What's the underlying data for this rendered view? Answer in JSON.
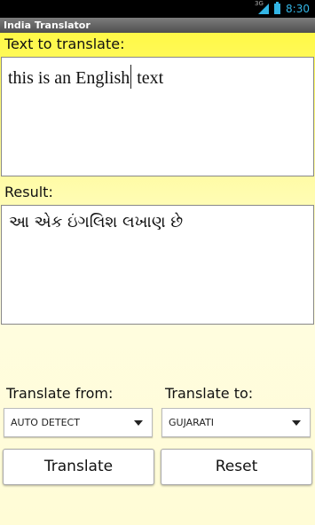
{
  "status_bar": {
    "network_label": "3G",
    "time": "8:30"
  },
  "app": {
    "title": "India Translator"
  },
  "input": {
    "label": "Text to translate:",
    "value_before_caret": "this is an English",
    "value_after_caret": " text"
  },
  "result": {
    "label": "Result:",
    "value": "આ એક ઇંગલિશ લખાણ છે"
  },
  "from": {
    "label": "Translate from:",
    "selected": "AUTO DETECT"
  },
  "to": {
    "label": "Translate to:",
    "selected": "GUJARATI"
  },
  "buttons": {
    "translate": "Translate",
    "reset": "Reset"
  }
}
